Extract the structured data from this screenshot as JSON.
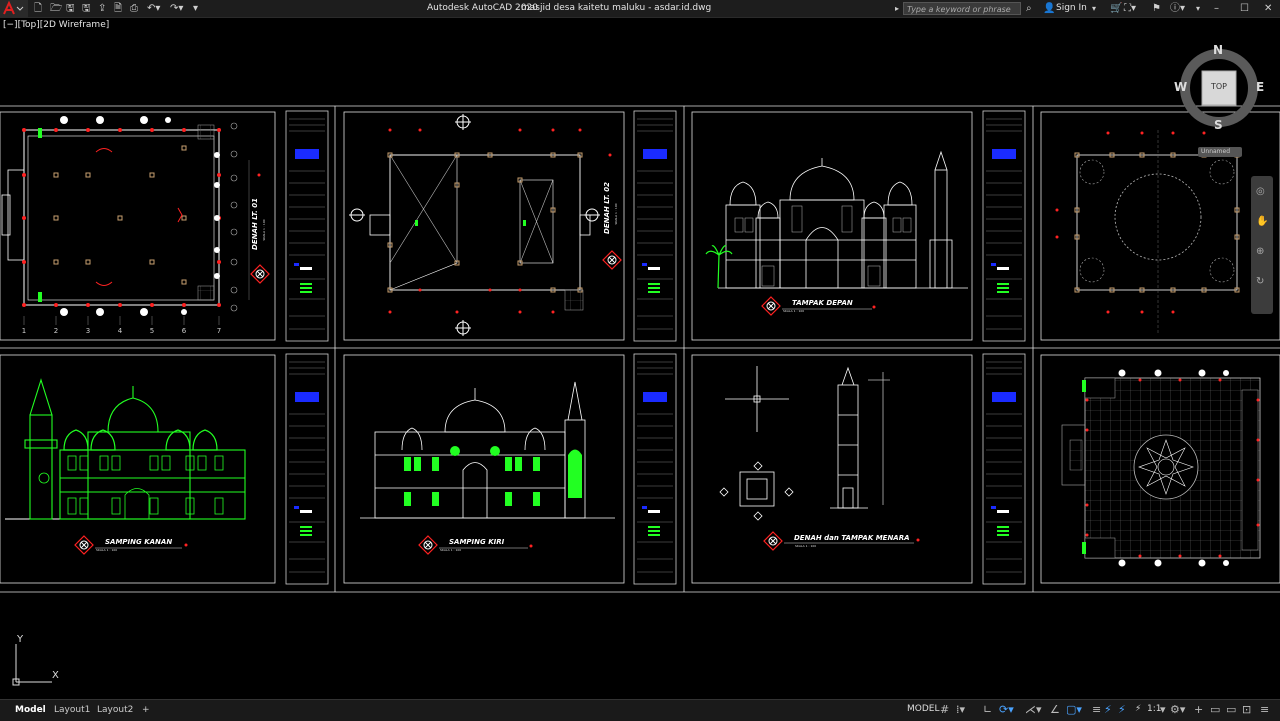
{
  "titlebar": {
    "app_title": "Autodesk AutoCAD 2020",
    "file_name": "masjid desa kaitetu maluku - asdar.id.dwg",
    "search_placeholder": "Type a keyword or phrase",
    "sign_in": "Sign In"
  },
  "viewport": {
    "label": "[−][Top][2D Wireframe]"
  },
  "viewcube": {
    "north": "N",
    "south": "S",
    "east": "E",
    "west": "W",
    "top": "TOP",
    "ucs_name": "Unnamed"
  },
  "ucs": {
    "x": "X",
    "y": "Y"
  },
  "sheets": {
    "denah_lt01": "DENAH LT. 01",
    "denah_lt02": "DENAH LT. 02",
    "tampak_depan": "TAMPAK DEPAN",
    "samping_kanan": "SAMPING KANAN",
    "samping_kiri": "SAMPING KIRI",
    "denah_menara": "DENAH dan TAMPAK MENARA",
    "scale": "SKALA 1 : 100"
  },
  "grid_labels": [
    "1",
    "2",
    "3",
    "4",
    "5",
    "6",
    "7"
  ],
  "statusbar": {
    "tabs": [
      "Model",
      "Layout1",
      "Layout2"
    ],
    "add_tab": "+",
    "model_label": "MODEL",
    "scale": "1:1"
  },
  "colors": {
    "outline": "#ffffff",
    "green": "#22ff22",
    "red": "#ff2222",
    "blue": "#1a2bff",
    "tan": "#c8a070",
    "gray": "#8a8a8a"
  }
}
